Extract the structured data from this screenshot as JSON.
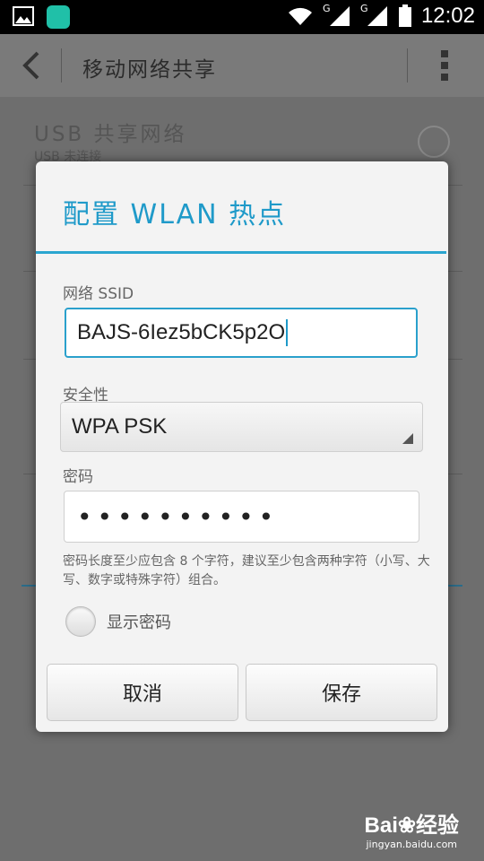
{
  "status_bar": {
    "network_1": "G",
    "network_2": "G",
    "time": "12:02",
    "icons": [
      "image-icon",
      "huawei-app-icon",
      "wifi-icon",
      "signal-icon",
      "signal-icon",
      "battery-icon"
    ]
  },
  "app_bar": {
    "title": "移动网络共享"
  },
  "background": {
    "usb_title": "USB 共享网络",
    "usb_sub": "USB 未连接"
  },
  "dialog": {
    "title": "配置 WLAN 热点",
    "ssid_label": "网络 SSID",
    "ssid_value": "BAJS-6Iez5bCK5p2O",
    "security_label": "安全性",
    "security_value": "WPA PSK",
    "password_label": "密码",
    "password_value": "••••••••••",
    "hint": "密码长度至少应包含 8 个字符，建议至少包含两种字符（小写、大写、数字或特殊字符）组合。",
    "show_password_label": "显示密码",
    "cancel_label": "取消",
    "save_label": "保存"
  },
  "watermark": {
    "brand": "Bai❀经验",
    "url": "jingyan.baidu.com"
  },
  "colors": {
    "accent": "#1f9ac9",
    "dim_bg": "#6e6e6e",
    "dialog_bg": "#f3f3f3"
  }
}
